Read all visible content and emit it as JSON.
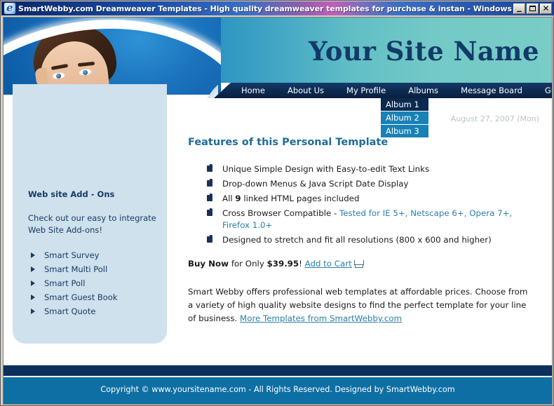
{
  "browser": {
    "title": "SmartWebby.com Dreamweaver Templates - High quality dreamweaver templates for purchase & instan - Windows Interne...",
    "minimize_label": "–",
    "maximize_label": "",
    "close_label": "×"
  },
  "header": {
    "site_title": "Your Site Name",
    "date": "August 27, 2007 (Mon)"
  },
  "nav": {
    "items": [
      {
        "label": "Home"
      },
      {
        "label": "About Us"
      },
      {
        "label": "My Profile"
      },
      {
        "label": "Albums"
      },
      {
        "label": "Message Board"
      },
      {
        "label": "Guest Book"
      }
    ],
    "dropdown": [
      {
        "label": "Album 1",
        "state": "active"
      },
      {
        "label": "Album 2",
        "state": "normal"
      },
      {
        "label": "Album 3",
        "state": "normal"
      }
    ]
  },
  "sidebar": {
    "title": "Web site Add - Ons",
    "blurb": "Check out our easy to integrate Web Site Add-ons!",
    "items": [
      {
        "label": "Smart Survey"
      },
      {
        "label": "Smart Multi Poll"
      },
      {
        "label": "Smart Poll"
      },
      {
        "label": "Smart Guest Book"
      },
      {
        "label": "Smart Quote"
      }
    ]
  },
  "main": {
    "heading": "Features of this Personal Template",
    "features": [
      {
        "parts": [
          {
            "text": "Unique Simple Design with Easy-to-edit Text Links",
            "style": "plain"
          }
        ]
      },
      {
        "parts": [
          {
            "text": "Drop-down Menus & Java Script Date Display",
            "style": "plain"
          }
        ]
      },
      {
        "parts": [
          {
            "text": "All ",
            "style": "plain"
          },
          {
            "text": "9",
            "style": "bold"
          },
          {
            "text": " linked HTML pages included",
            "style": "plain"
          }
        ]
      },
      {
        "parts": [
          {
            "text": "Cross Browser Compatible - ",
            "style": "plain"
          },
          {
            "text": "Tested for IE 5+, Netscape 6+, Opera 7+, Firefox 1.0+",
            "style": "link"
          }
        ]
      },
      {
        "parts": [
          {
            "text": "Designed to stretch and fit all resolutions (800 x 600 and higher)",
            "style": "plain"
          }
        ]
      }
    ],
    "buy": {
      "label_bold": "Buy Now",
      "label_mid": " for Only ",
      "price": "$39.95",
      "exclaim": "! ",
      "cart_link": "Add to Cart"
    },
    "paragraph": {
      "text": "Smart Webby offers professional web templates at affordable prices. Choose from a variety of high quality website designs to find the perfect template for your line of business. ",
      "link": "More Templates from SmartWebby.com"
    }
  },
  "footer": {
    "text": "Copyright © www.yoursitename.com - All Rights Reserved. Designed by SmartWebby.com"
  },
  "colors": {
    "nav_bar": "#0d2a50",
    "dropdown_active": "#0a2a52",
    "dropdown_normal": "#1881b5",
    "heading": "#1d6d96",
    "link": "#2a7fa8",
    "sidebar_bg": "#cfe1ec",
    "sidebar_text": "#173b66",
    "footer_bar": "#0e6fa4",
    "footer_rule": "#0c2f5c",
    "site_title": "#123a68"
  }
}
